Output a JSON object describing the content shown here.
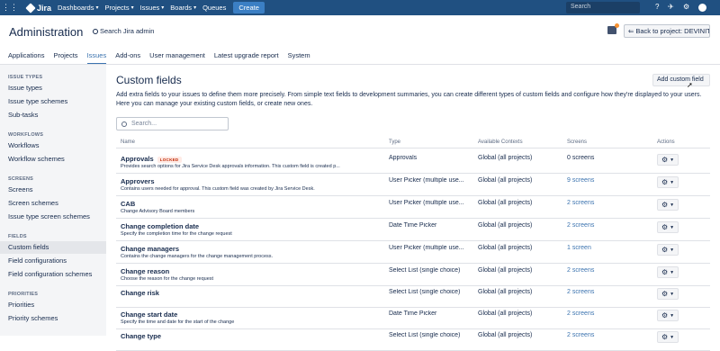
{
  "topnav": {
    "logo": "Jira",
    "items": [
      {
        "label": "Dashboards",
        "dropdown": true
      },
      {
        "label": "Projects",
        "dropdown": true
      },
      {
        "label": "Issues",
        "dropdown": true
      },
      {
        "label": "Boards",
        "dropdown": true
      },
      {
        "label": "Queues",
        "dropdown": false
      }
    ],
    "create_label": "Create",
    "search_placeholder": "Search",
    "colors": {
      "bar": "#205081",
      "create": "#3b7fc4"
    }
  },
  "header": {
    "title": "Administration",
    "search_label": "Search Jira admin",
    "back_label": "Back to project: DEVINITI"
  },
  "tabs": [
    {
      "label": "Applications",
      "active": false
    },
    {
      "label": "Projects",
      "active": false
    },
    {
      "label": "Issues",
      "active": true
    },
    {
      "label": "Add-ons",
      "active": false
    },
    {
      "label": "User management",
      "active": false
    },
    {
      "label": "Latest upgrade report",
      "active": false
    },
    {
      "label": "System",
      "active": false
    }
  ],
  "sidebar": {
    "sections": [
      {
        "heading": "ISSUE TYPES",
        "items": [
          "Issue types",
          "Issue type schemes",
          "Sub-tasks"
        ]
      },
      {
        "heading": "WORKFLOWS",
        "items": [
          "Workflows",
          "Workflow schemes"
        ]
      },
      {
        "heading": "SCREENS",
        "items": [
          "Screens",
          "Screen schemes",
          "Issue type screen schemes"
        ]
      },
      {
        "heading": "FIELDS",
        "items": [
          "Custom fields",
          "Field configurations",
          "Field configuration schemes"
        ]
      },
      {
        "heading": "PRIORITIES",
        "items": [
          "Priorities",
          "Priority schemes"
        ]
      }
    ],
    "selected": "Custom fields"
  },
  "main": {
    "title": "Custom fields",
    "add_button": "Add custom field",
    "description": "Add extra fields to your issues to define them more precisely. From simple text fields to development summaries, you can create different types of custom fields and configure how they're displayed to your users. Here you can manage your existing custom fields, or create new ones.",
    "search_placeholder": "Search...",
    "columns": [
      "Name",
      "Type",
      "Available Contexts",
      "Screens",
      "Actions"
    ],
    "rows": [
      {
        "name": "Approvals",
        "locked": "LOCKED",
        "desc": "Provides search options for Jira Service Desk approvals information. This custom field is created p...",
        "type": "Approvals",
        "context": "Global (all projects)",
        "screens": "0 screens",
        "screens_link": false
      },
      {
        "name": "Approvers",
        "locked": "",
        "desc": "Contains users needed for approval. This custom field was created by Jira Service Desk.",
        "type": "User Picker (multiple use...",
        "context": "Global (all projects)",
        "screens": "9 screens",
        "screens_link": true
      },
      {
        "name": "CAB",
        "locked": "",
        "desc": "Change Advisory Board members",
        "type": "User Picker (multiple use...",
        "context": "Global (all projects)",
        "screens": "2 screens",
        "screens_link": true
      },
      {
        "name": "Change completion date",
        "locked": "",
        "desc": "Specify the completion time for the change request",
        "type": "Date Time Picker",
        "context": "Global (all projects)",
        "screens": "2 screens",
        "screens_link": true
      },
      {
        "name": "Change managers",
        "locked": "",
        "desc": "Contains the change managers for the change management process.",
        "type": "User Picker (multiple use...",
        "context": "Global (all projects)",
        "screens": "1 screen",
        "screens_link": true
      },
      {
        "name": "Change reason",
        "locked": "",
        "desc": "Choose the reason for the change request",
        "type": "Select List (single choice)",
        "context": "Global (all projects)",
        "screens": "2 screens",
        "screens_link": true
      },
      {
        "name": "Change risk",
        "locked": "",
        "desc": "",
        "type": "Select List (single choice)",
        "context": "Global (all projects)",
        "screens": "2 screens",
        "screens_link": true
      },
      {
        "name": "Change start date",
        "locked": "",
        "desc": "Specify the time and date for the start of the change",
        "type": "Date Time Picker",
        "context": "Global (all projects)",
        "screens": "2 screens",
        "screens_link": true
      },
      {
        "name": "Change type",
        "locked": "",
        "desc": "",
        "type": "Select List (single choice)",
        "context": "Global (all projects)",
        "screens": "2 screens",
        "screens_link": true
      }
    ]
  }
}
